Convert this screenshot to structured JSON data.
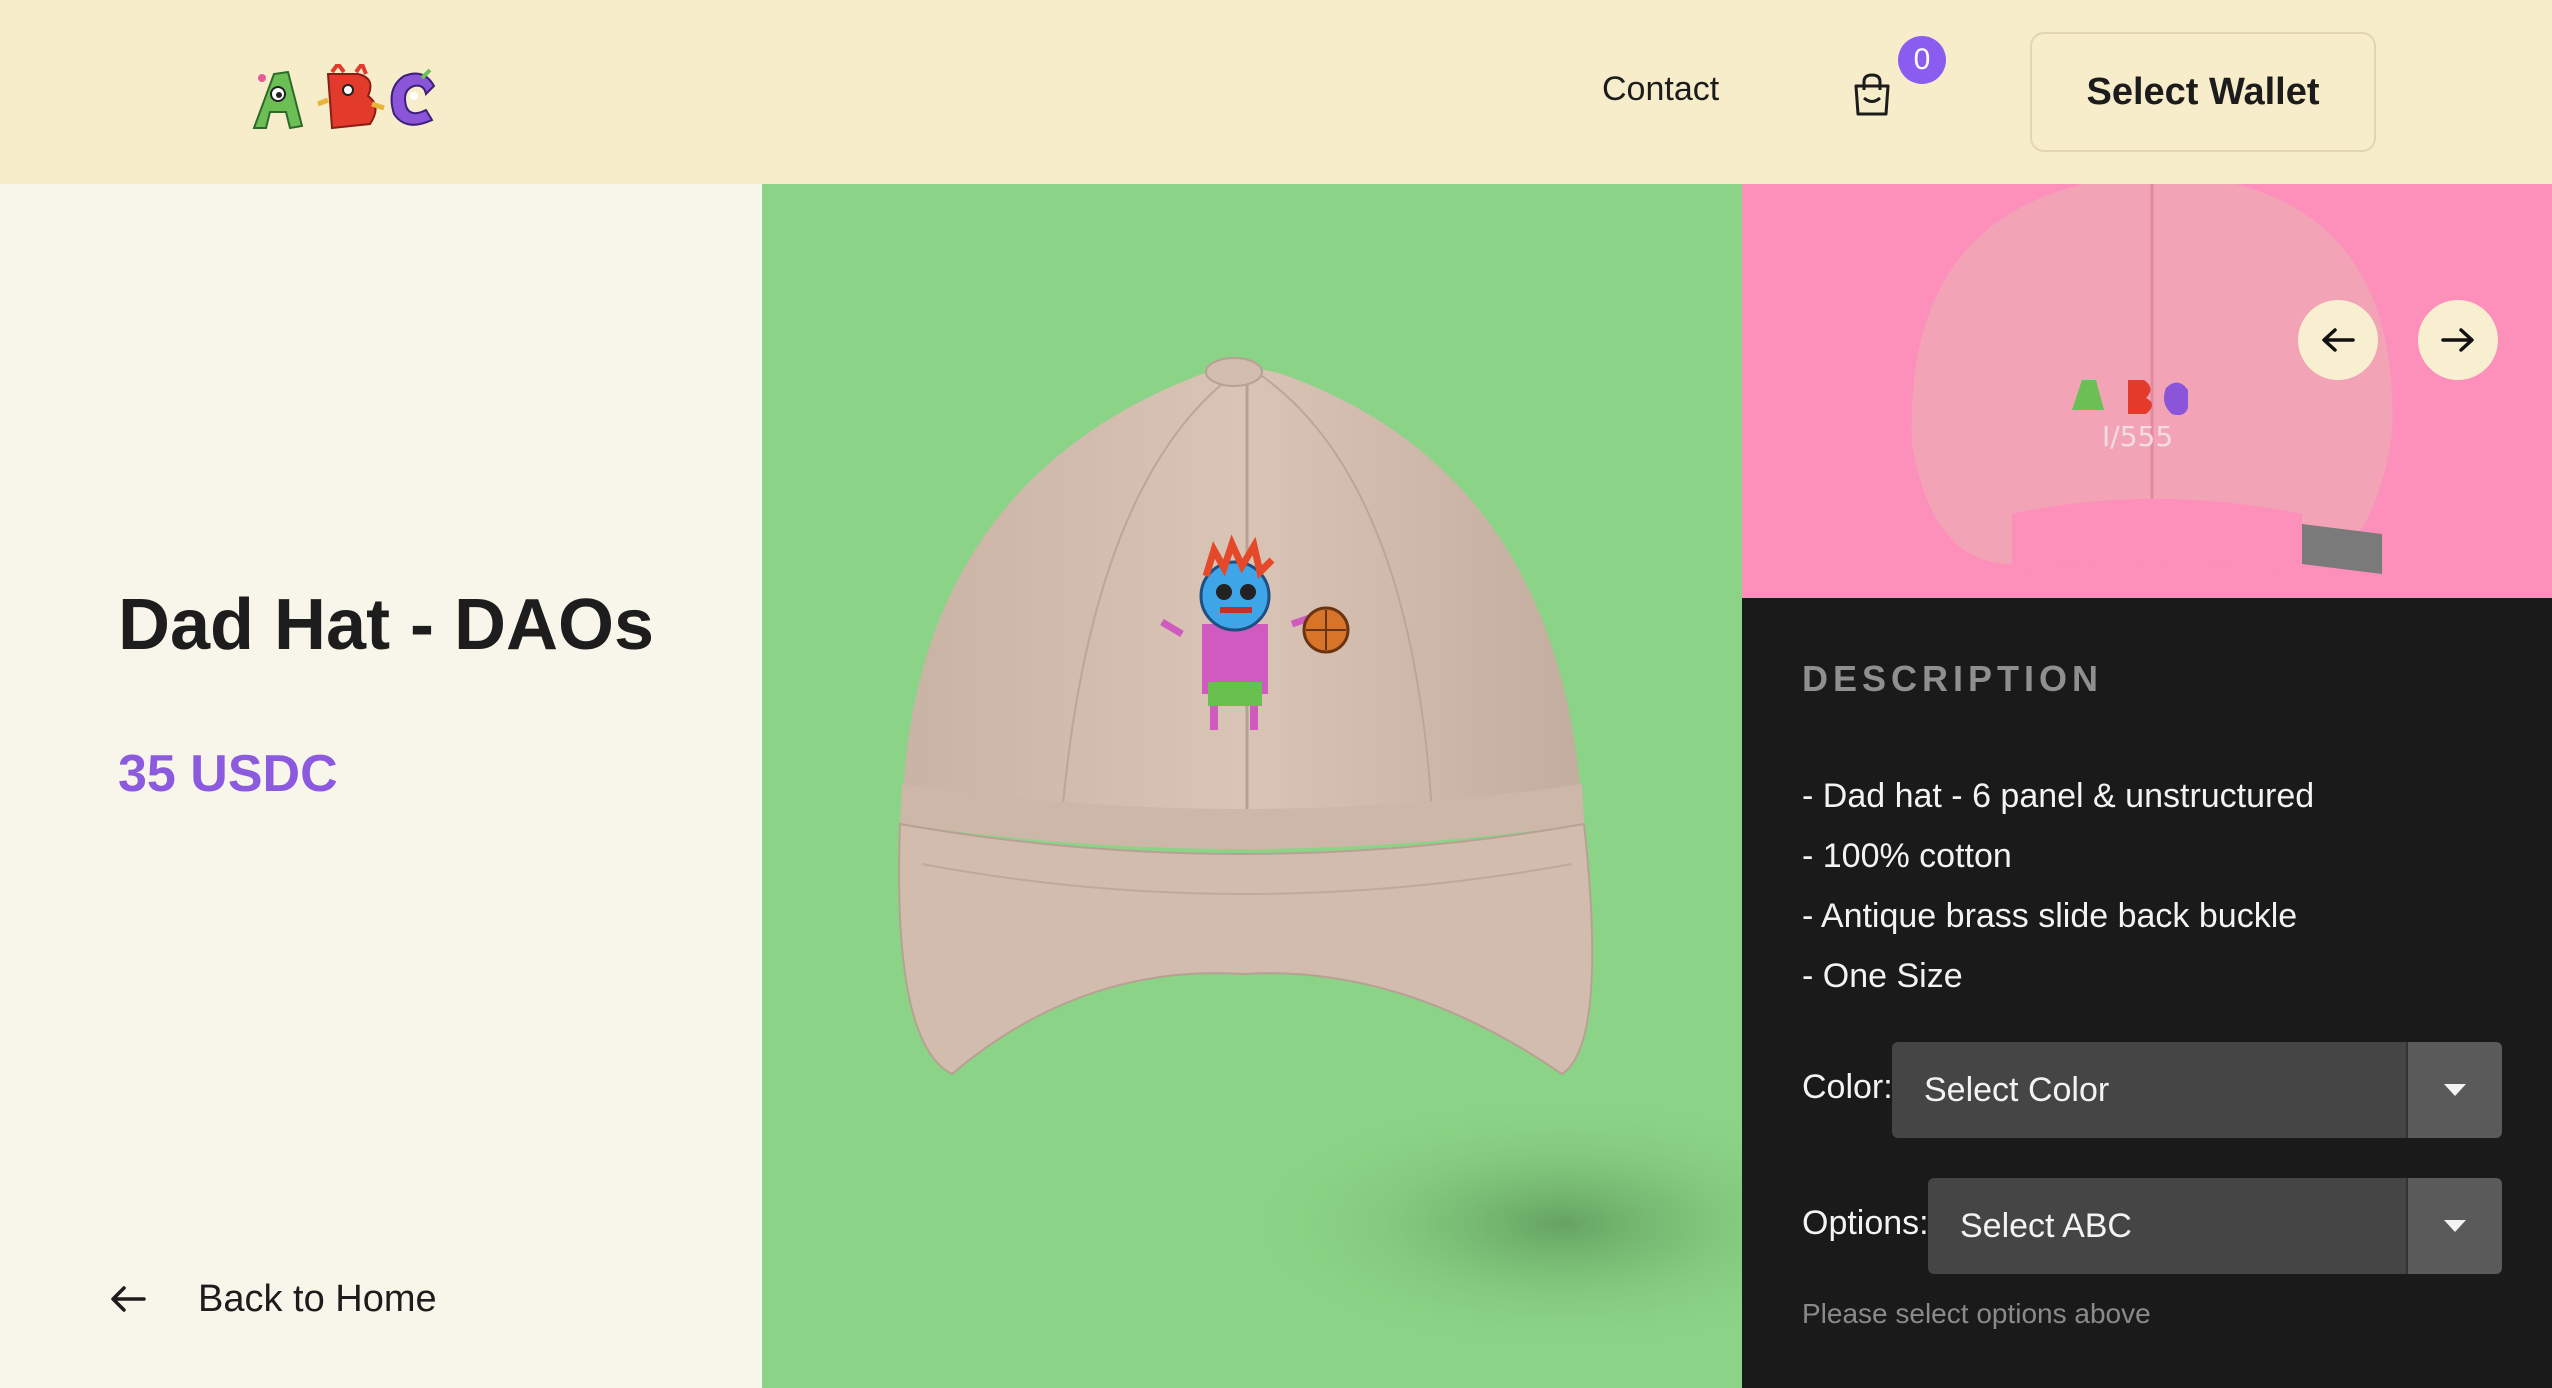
{
  "header": {
    "logo_text": "ABC",
    "contact_label": "Contact",
    "cart_count": "0",
    "wallet_label": "Select Wallet"
  },
  "product": {
    "title": "Dad Hat - DAOs",
    "price": "35 USDC"
  },
  "nav": {
    "back_label": "Back to Home"
  },
  "description": {
    "heading": "DESCRIPTION",
    "items": [
      "- Dad hat - 6 panel & unstructured",
      "- 100% cotton",
      "- Antique brass slide back buckle",
      "- One Size"
    ]
  },
  "options": {
    "color_label": "Color:",
    "color_value": "Select Color",
    "option_label": "Options:",
    "option_value": "Select ABC",
    "hint": "Please select options above"
  },
  "colors": {
    "header_bg": "#f7edca",
    "accent_purple": "#8c5ade",
    "main_bg_green": "#8bd386",
    "thumb_bg_pink": "#fd8fbb",
    "desc_bg": "#1a1a1a"
  },
  "icons": {
    "cart": "shopping-bag-icon",
    "back": "arrow-left-icon",
    "prev": "arrow-left-icon",
    "next": "arrow-right-icon",
    "dropdown": "caret-down-icon"
  }
}
